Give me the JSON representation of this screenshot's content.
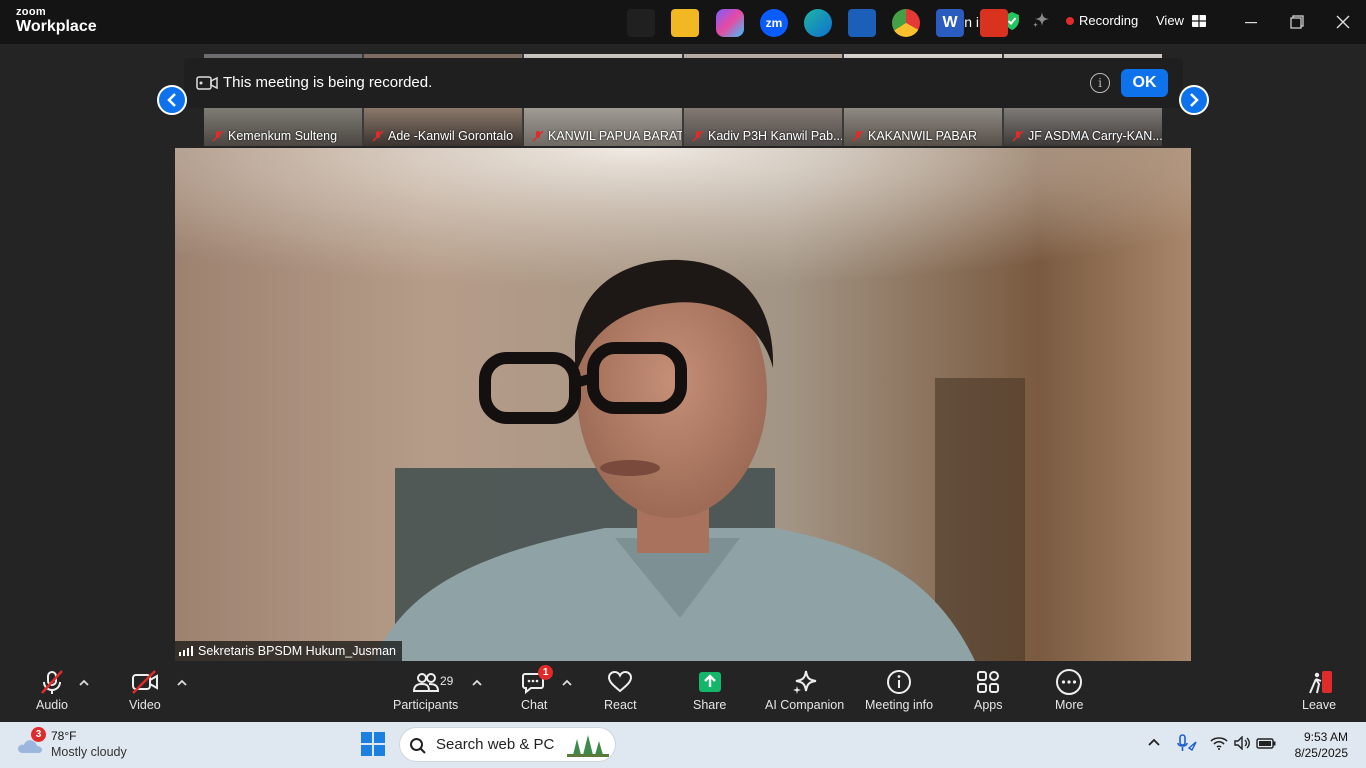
{
  "app": {
    "brand_top": "zoom",
    "brand_bottom": "Workplace"
  },
  "titlebar": {
    "sign_in": "Sign in",
    "recording": "Recording",
    "view": "View"
  },
  "banner": {
    "message": "This meeting is being recorded.",
    "ok": "OK"
  },
  "thumbnails": [
    {
      "name": "Kemenkum Sulteng"
    },
    {
      "name": "Ade -Kanwil Gorontalo"
    },
    {
      "name": "KANWIL PAPUA BARAT"
    },
    {
      "name": "Kadiv P3H Kanwil Pab..."
    },
    {
      "name": "KAKANWIL PABAR"
    },
    {
      "name": "JF ASDMA Carry-KAN..."
    }
  ],
  "main_video": {
    "name": "Sekretaris BPSDM Hukum_Jusman"
  },
  "toolbar": {
    "audio": "Audio",
    "video": "Video",
    "participants": "Participants",
    "participants_count": "29",
    "chat": "Chat",
    "chat_badge": "1",
    "react": "React",
    "share": "Share",
    "ai_companion": "AI Companion",
    "meeting_info": "Meeting info",
    "apps": "Apps",
    "more": "More",
    "leave": "Leave"
  },
  "taskbar": {
    "weather_badge": "3",
    "temperature": "78°F",
    "condition": "Mostly cloudy",
    "search_placeholder": "Search web & PC",
    "time": "9:53 AM",
    "date": "8/25/2025"
  },
  "colors": {
    "accent": "#0e72ed",
    "share_green": "#12b76a",
    "recording_red": "#e02b2b"
  }
}
